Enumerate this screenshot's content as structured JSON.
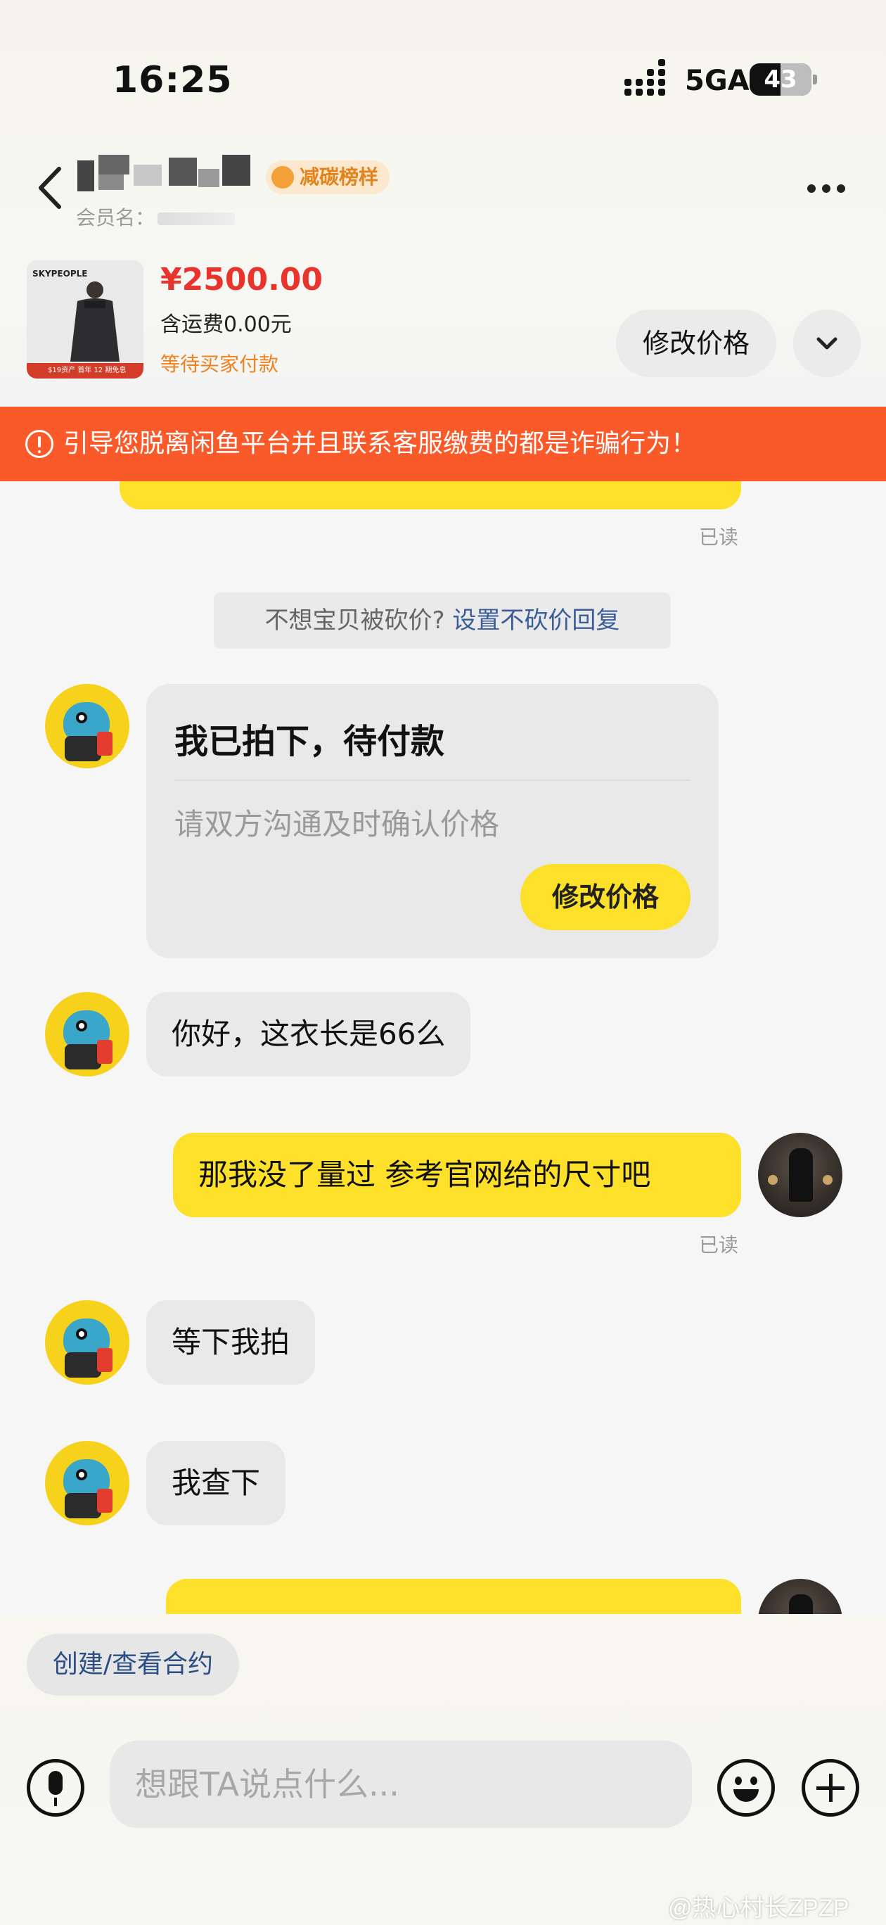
{
  "status_bar": {
    "time": "16:25",
    "network": "5GA",
    "battery": "43"
  },
  "header": {
    "badge": "减碳榜样",
    "member_label": "会员名："
  },
  "product": {
    "price": "¥2500.00",
    "shipping": "含运费0.00元",
    "status": "等待买家付款",
    "edit_price_label": "修改价格",
    "thumb_brand": "SKYPEOPLE",
    "thumb_banner": "$19资产  首年 12 期免息"
  },
  "warning": {
    "text": "引导您脱离闲鱼平台并且联系客服缴费的都是诈骗行为！"
  },
  "chat": {
    "read_label": "已读",
    "system_tip_text": "不想宝贝被砍价? ",
    "system_tip_link": "设置不砍价回复",
    "card": {
      "title": "我已拍下，待付款",
      "desc": "请双方沟通及时确认价格",
      "button": "修改价格"
    },
    "messages": [
      {
        "from": "other",
        "text": "你好，这衣长是66么"
      },
      {
        "from": "me",
        "text": "那我没了量过 参考官网给的尺寸吧"
      },
      {
        "from": "other",
        "text": "等下我拍"
      },
      {
        "from": "other",
        "text": "我查下"
      }
    ]
  },
  "footer": {
    "contract_label": "创建/查看合约",
    "input_placeholder": "想跟TA说点什么...",
    "watermark": "@热心村长ZPZP"
  },
  "colors": {
    "accent_yellow": "#fde02a",
    "warning_orange": "#fa5a2a",
    "price_red": "#e8342c",
    "link_blue": "#3a5d9a"
  }
}
